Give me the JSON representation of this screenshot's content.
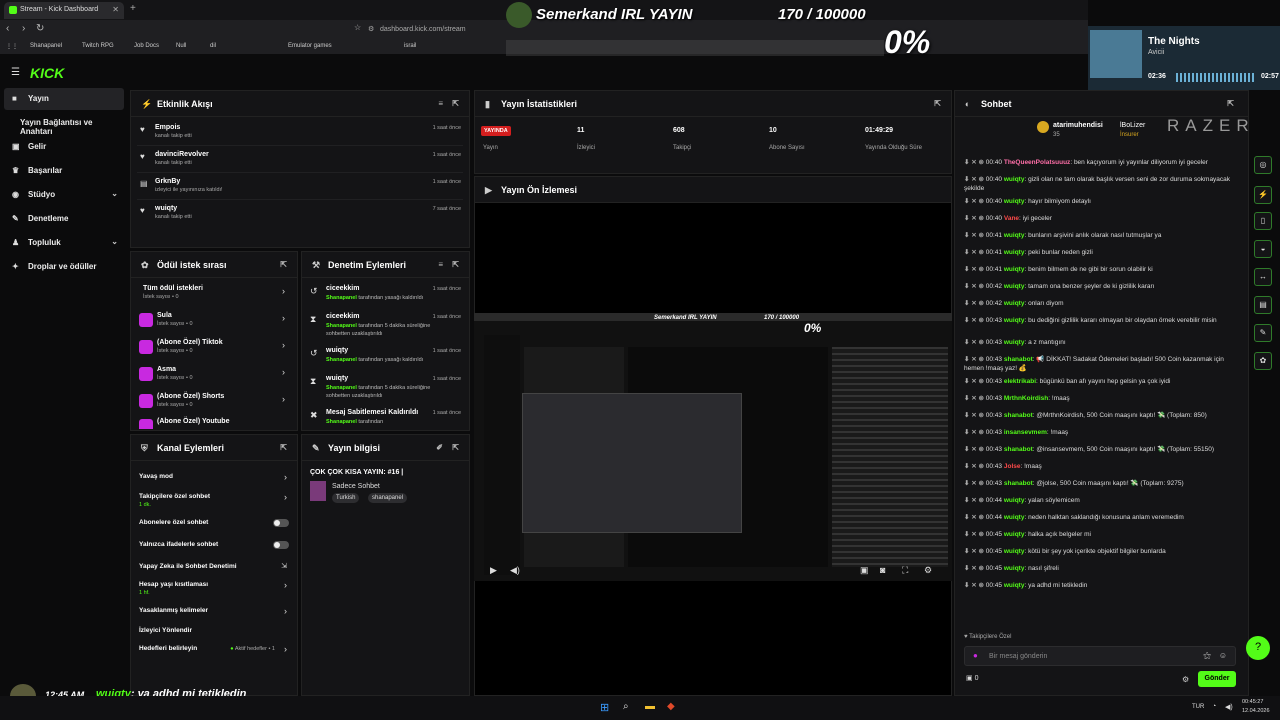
{
  "browser": {
    "tab_title": "Stream - Kick Dashboard",
    "url": "dashboard.kick.com/stream",
    "bookmarks": [
      "Shanapanel",
      "Twitch RPG",
      "Job Docs",
      "Null",
      "dil",
      "",
      "",
      "",
      "Emulator games",
      "",
      "israil"
    ]
  },
  "overlay": {
    "title": "Semerkand IRL YAYIN",
    "counter": "170 / 100000",
    "percent": "0%",
    "clock": "12:45 AM",
    "chat_user": "wuiqty",
    "chat_text": ": ya adhd mi tetikledin"
  },
  "now_playing": {
    "title": "The Nights",
    "artist": "Avicii",
    "elapsed": "02:36",
    "total": "02:57"
  },
  "sidebar": {
    "items": [
      {
        "label": "Yayın",
        "icon": "camera-icon"
      },
      {
        "label": "Yayın Bağlantısı ve Anahtarı",
        "icon": ""
      },
      {
        "label": "Gelir",
        "icon": "dollar-icon"
      },
      {
        "label": "Başarılar",
        "icon": "trophy-icon"
      },
      {
        "label": "Stüdyo",
        "icon": "studio-icon"
      },
      {
        "label": "Denetleme",
        "icon": "wrench-icon"
      },
      {
        "label": "Topluluk",
        "icon": "community-icon"
      },
      {
        "label": "Droplar ve ödüller",
        "icon": "gift-icon"
      }
    ]
  },
  "activity": {
    "title": "Etkinlik Akışı",
    "items": [
      {
        "name": "Empois",
        "sub": "kanalı takip etti",
        "time": "1 saat önce"
      },
      {
        "name": "davinciRevolver",
        "sub": "kanalı takip etti",
        "time": "1 saat önce"
      },
      {
        "name": "GrknBy",
        "sub": "izleyici ile yayınınıza katıldı!",
        "time": "1 saat önce"
      },
      {
        "name": "wuiqty",
        "sub": "kanalı takip etti",
        "time": "7 saat önce"
      }
    ]
  },
  "stats": {
    "title": "Yayın İstatistikleri",
    "live": "YAYINDA",
    "items": [
      {
        "value": "",
        "label": "Yayın"
      },
      {
        "value": "11",
        "label": "İzleyici"
      },
      {
        "value": "608",
        "label": "Takipçi"
      },
      {
        "value": "10",
        "label": "Abone Sayısı"
      },
      {
        "value": "01:49:29",
        "label": "Yayında Olduğu Süre"
      }
    ]
  },
  "preview": {
    "title": "Yayın Ön İzlemesi"
  },
  "rewards": {
    "title": "Ödül istek sırası",
    "all": {
      "name": "Tüm ödül istekleri",
      "sub": "İstek sayısı • 0"
    },
    "items": [
      {
        "name": "Sula",
        "sub": "İstek sayısı • 0"
      },
      {
        "name": "(Abone Özel) Tiktok",
        "sub": "İstek sayısı • 0"
      },
      {
        "name": "Asma",
        "sub": "İstek sayısı • 0"
      },
      {
        "name": "(Abone Özel) Shorts",
        "sub": "İstek sayısı • 0"
      },
      {
        "name": "(Abone Özel) Youtube",
        "sub": ""
      }
    ]
  },
  "moderation": {
    "title": "Denetim Eylemleri",
    "items": [
      {
        "name": "ciceekkim",
        "actor": "Shanapanel",
        "desc": " tarafından yasağı kaldırıldı",
        "time": "1 saat önce",
        "icon": "undo-icon"
      },
      {
        "name": "ciceekkim",
        "actor": "Shanapanel",
        "desc": " tarafından 5 dakika süreliğine sohbetten uzaklaştırıldı",
        "time": "1 saat önce",
        "icon": "hourglass-icon"
      },
      {
        "name": "wuiqty",
        "actor": "Shanapanel",
        "desc": " tarafından yasağı kaldırıldı",
        "time": "1 saat önce",
        "icon": "undo-icon"
      },
      {
        "name": "wuiqty",
        "actor": "Shanapanel",
        "desc": " tarafından 5 dakika süreliğine sohbetten uzaklaştırıldı",
        "time": "1 saat önce",
        "icon": "hourglass-icon"
      },
      {
        "name": "Mesaj Sabitlemesi Kaldırıldı",
        "actor": "Shanapanel",
        "desc": " tarafından",
        "time": "1 saat önce",
        "icon": "unpin-icon"
      }
    ]
  },
  "channel_actions": {
    "title": "Kanal Eylemleri",
    "items": [
      {
        "label": "Yavaş mod",
        "sub": "",
        "control": "chevron"
      },
      {
        "label": "Takipçilere özel sohbet",
        "sub": "1 dk.",
        "control": "chevron"
      },
      {
        "label": "Abonelere özel sohbet",
        "sub": "",
        "control": "toggle"
      },
      {
        "label": "Yalnızca ifadelerle sohbet",
        "sub": "",
        "control": "toggle"
      },
      {
        "label": "Yapay Zeka ile Sohbet Denetimi",
        "sub": "",
        "control": "external"
      },
      {
        "label": "Hesap yaşı kısıtlaması",
        "sub": "1 hf.",
        "control": "chevron"
      },
      {
        "label": "Yasaklanmış kelimeler",
        "sub": "",
        "control": "chevron"
      },
      {
        "label": "İzleyici Yönlendir",
        "sub": "",
        "control": "none"
      },
      {
        "label": "Hedefleri belirleyin",
        "sub": "",
        "control": "chevron",
        "extra": "Aktif hedefler • 1"
      }
    ]
  },
  "stream_info": {
    "title": "Yayın bilgisi",
    "stream_title": "ÇOK ÇOK KISA YAYIN: #16 |",
    "category": "Sadece Sohbet",
    "tags": [
      "Turkish",
      "shanapanel"
    ]
  },
  "chat": {
    "title": "Sohbet",
    "top_user": "atarimuhendisi",
    "top_user2": "lBoLizer",
    "top_user3": "İnsurer",
    "top_count": "35",
    "messages": [
      {
        "time": "00:40",
        "user": "TheQueenPolatsuuuz",
        "color": "#ff6fa8",
        "text": "ben kaçıyorum iyi yayınlar diliyorum iyi geceler"
      },
      {
        "time": "00:40",
        "user": "wuiqty",
        "color": "#53fc18",
        "text": "gizli olan ne tam olarak başlık versen seni de zor duruma sokmayacak şekilde"
      },
      {
        "time": "00:40",
        "user": "wuiqty",
        "color": "#53fc18",
        "text": "hayır bilmiyom detaylı"
      },
      {
        "time": "00:40",
        "user": "Vane",
        "color": "#ff4a4a",
        "text": "iyi geceler"
      },
      {
        "time": "00:41",
        "user": "wuiqty",
        "color": "#53fc18",
        "text": "bunların arşivini anlık olarak nasıl tutmuşlar ya"
      },
      {
        "time": "00:41",
        "user": "wuiqty",
        "color": "#53fc18",
        "text": "peki bunlar neden gizli"
      },
      {
        "time": "00:41",
        "user": "wuiqty",
        "color": "#53fc18",
        "text": "benim bilmem de ne gibi bir sorun olabilir ki"
      },
      {
        "time": "00:42",
        "user": "wuiqty",
        "color": "#53fc18",
        "text": "tamam ona benzer şeyler de ki gizlilik kararı"
      },
      {
        "time": "00:42",
        "user": "wuiqty",
        "color": "#53fc18",
        "text": "onları diyom"
      },
      {
        "time": "00:43",
        "user": "wuiqty",
        "color": "#53fc18",
        "text": "bu dediğini gizlilik kararı olmayan bir olaydan örnek verebilir misin"
      },
      {
        "time": "00:43",
        "user": "wuiqty",
        "color": "#53fc18",
        "text": "a z mantıgını"
      },
      {
        "time": "00:43",
        "user": "shanabot",
        "color": "#53fc18",
        "text": "📢 DİKKAT! Sadakat Ödemeleri başladı! 500 Coin kazanmak için hemen !maaş yaz! 💰"
      },
      {
        "time": "00:43",
        "user": "elektrikabi",
        "color": "#53fc18",
        "text": "bügünkü ban afı yayını hep gelsin ya çok iyidi"
      },
      {
        "time": "00:43",
        "user": "MrthnKoirdish",
        "color": "#53fc18",
        "text": "!maaş"
      },
      {
        "time": "00:43",
        "user": "shanabot",
        "color": "#53fc18",
        "text": "@MrthnKoirdish, 500 Coin maaşını kaptı! 💸 (Toplam: 850)"
      },
      {
        "time": "00:43",
        "user": "insansevmem",
        "color": "#53fc18",
        "text": "!maaş"
      },
      {
        "time": "00:43",
        "user": "shanabot",
        "color": "#53fc18",
        "text": "@insansevmem, 500 Coin maaşını kaptı! 💸 (Toplam: 55150)"
      },
      {
        "time": "00:43",
        "user": "Jolse",
        "color": "#ff4a4a",
        "text": "!maaş"
      },
      {
        "time": "00:43",
        "user": "shanabot",
        "color": "#53fc18",
        "text": "@jolse, 500 Coin maaşını kaptı! 💸 (Toplam: 9275)"
      },
      {
        "time": "00:44",
        "user": "wuiqty",
        "color": "#53fc18",
        "text": "yalan söylemicem"
      },
      {
        "time": "00:44",
        "user": "wuiqty",
        "color": "#53fc18",
        "text": "neden halktan saklandığı konusuna anlam veremedim"
      },
      {
        "time": "00:45",
        "user": "wuiqty",
        "color": "#53fc18",
        "text": "halka açık belgeler mi"
      },
      {
        "time": "00:45",
        "user": "wuiqty",
        "color": "#53fc18",
        "text": "kötü bir şey yok içerikte objektif bilgiler bunlarda"
      },
      {
        "time": "00:45",
        "user": "wuiqty",
        "color": "#53fc18",
        "text": "nasıl şifreli"
      },
      {
        "time": "00:45",
        "user": "wuiqty",
        "color": "#53fc18",
        "text": "ya adhd mi tetikledin"
      }
    ],
    "followers_only": "Takipçilere Özel",
    "input_placeholder": "Bir mesaj gönderin",
    "points": "0",
    "send": "Gönder"
  },
  "brand_watermark": "RAZER",
  "taskbar": {
    "lang": "TUR",
    "time": "00:45:27",
    "date": "12.04.2026"
  }
}
